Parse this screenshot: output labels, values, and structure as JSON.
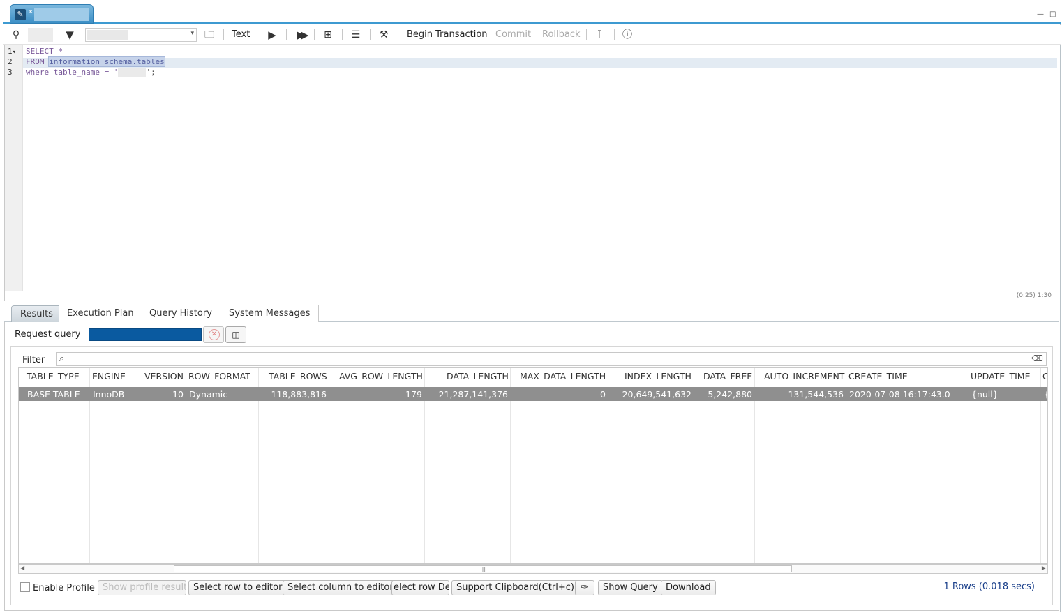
{
  "tab": {
    "modified_marker": "*"
  },
  "toolbar": {
    "text_label": "Text",
    "begin_transaction": "Begin Transaction",
    "commit": "Commit",
    "rollback": "Rollback"
  },
  "editor": {
    "lines": [
      {
        "num": "1",
        "fold": "▾",
        "parts": [
          "SELECT *"
        ]
      },
      {
        "num": "2",
        "parts": [
          "FROM ",
          "information_schema.tables"
        ]
      },
      {
        "num": "3",
        "parts": [
          "where table_name = '",
          "';"
        ]
      }
    ],
    "cursor_position": "(0:25) 1:30"
  },
  "results_tabs": [
    "Results",
    "Execution Plan",
    "Query History",
    "System Messages"
  ],
  "request_query_label": "Request query",
  "filter": {
    "label": "Filter"
  },
  "grid": {
    "columns": [
      "TABLE_TYPE",
      "ENGINE",
      "VERSION",
      "ROW_FORMAT",
      "TABLE_ROWS",
      "AVG_ROW_LENGTH",
      "DATA_LENGTH",
      "MAX_DATA_LENGTH",
      "INDEX_LENGTH",
      "DATA_FREE",
      "AUTO_INCREMENT",
      "CREATE_TIME",
      "UPDATE_TIME",
      "C"
    ],
    "rows": [
      [
        "BASE TABLE",
        "InnoDB",
        "10",
        "Dynamic",
        "118,883,816",
        "179",
        "21,287,141,376",
        "0",
        "20,649,541,632",
        "5,242,880",
        "131,544,536",
        "2020-07-08 16:17:43.0",
        "{null}",
        "{"
      ]
    ]
  },
  "bottom": {
    "enable_profile": "Enable Profile",
    "show_profile_result": "Show profile result",
    "select_row_to_editor": "Select row to editor",
    "select_column_to_editor": "Select column to editor",
    "select_row_detail": "elect row Deta",
    "support_clipboard": "Support Clipboard(Ctrl+c)",
    "show_query": "Show Query",
    "download": "Download",
    "row_count": "1 Rows  (0.018 secs)"
  }
}
